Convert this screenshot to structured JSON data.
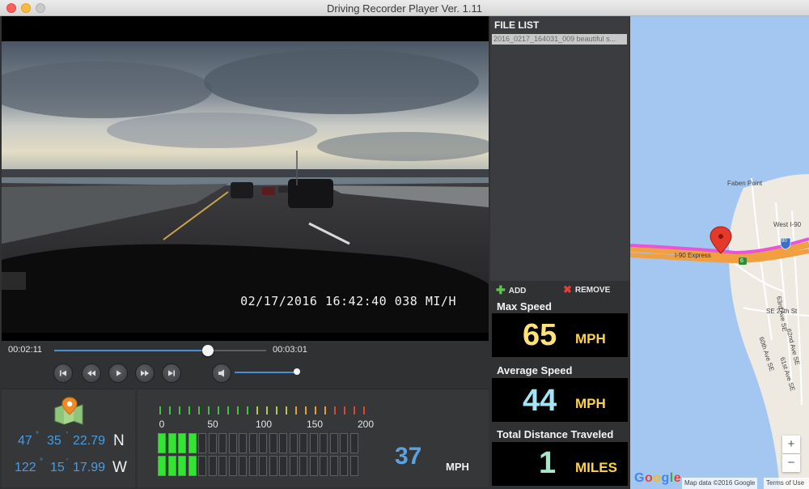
{
  "window": {
    "title": "Driving Recorder Player Ver. 1.11"
  },
  "video": {
    "overlay_text": "02/17/2016 16:42:40  038 MI/H"
  },
  "playback": {
    "current_time": "00:02:11",
    "total_time": "00:03:01",
    "progress": 0.724,
    "volume": 1.0
  },
  "controls": {
    "skip_back_icon": "skip-to-start-icon",
    "rewind_icon": "rewind-icon",
    "play_icon": "play-icon",
    "fast_forward_icon": "fast-forward-icon",
    "skip_forward_icon": "skip-to-end-icon",
    "volume_icon": "speaker-icon"
  },
  "gps": {
    "lat": {
      "deg": "47",
      "min": "35",
      "sec": "22.79",
      "dir": "N"
    },
    "lon": {
      "deg": "122",
      "min": "15",
      "sec": "17.99",
      "dir": "W"
    }
  },
  "speedometer": {
    "tick_labels": [
      "0",
      "50",
      "100",
      "150",
      "200"
    ],
    "max": 200,
    "segments_total": 20,
    "segments_lit": 4,
    "current_speed": "37",
    "unit": "MPH"
  },
  "file_list": {
    "title": "FILE LIST",
    "items": [
      "2016_0217_164031_009 beautiful s..."
    ],
    "add_label": "ADD",
    "remove_label": "REMOVE"
  },
  "stats": {
    "max_speed": {
      "label": "Max Speed",
      "value": "65",
      "unit": "MPH",
      "color": "#ffe27a"
    },
    "avg_speed": {
      "label": "Average Speed",
      "value": "44",
      "unit": "MPH",
      "color": "#a6e3f5"
    },
    "distance": {
      "label": "Total Distance Traveled",
      "value": "1",
      "unit": "MILES",
      "color": "#a6e7c8"
    }
  },
  "map": {
    "labels": {
      "faben": "Faben Point",
      "west_i90": "West I-90",
      "i90_express": "I-90 Express",
      "shield_6": "6",
      "shield_90": "90",
      "ave63": "63rd Ave SE",
      "se27": "SE 27th St",
      "ave62": "62nd Ave SE",
      "ave60": "60th Ave SE",
      "ave61": "61st Ave SE"
    },
    "zoom_in": "+",
    "zoom_out": "−",
    "google": "Google",
    "attribution": "Map data ©2016 Google",
    "terms": "Terms of Use"
  },
  "colors": {
    "accent": "#4a8fd6",
    "speed_bar": "#34e334"
  }
}
